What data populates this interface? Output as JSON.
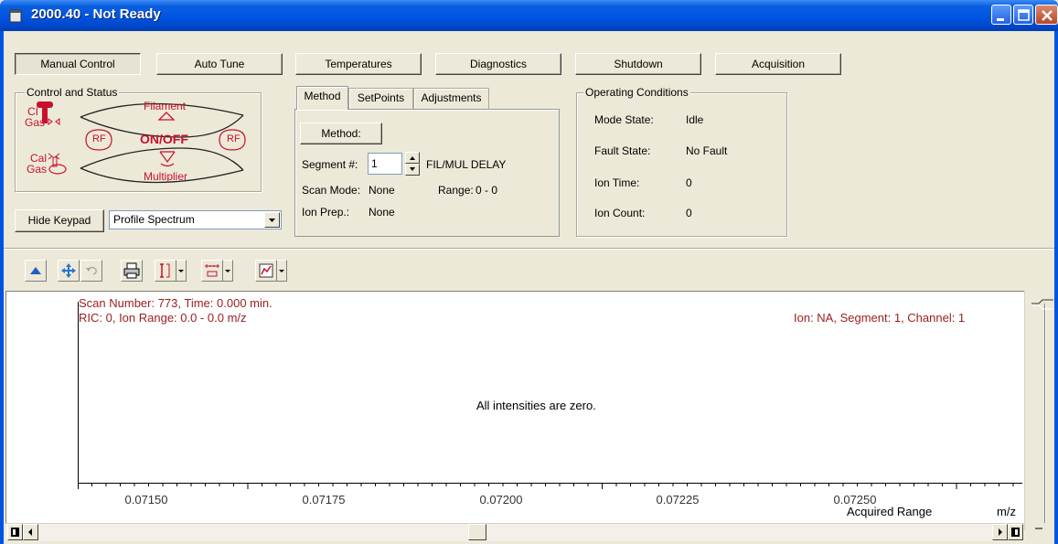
{
  "window": {
    "title": "2000.40 - Not Ready"
  },
  "top_buttons": [
    {
      "label": "Manual Control",
      "pressed": true
    },
    {
      "label": "Auto Tune",
      "pressed": false
    },
    {
      "label": "Temperatures",
      "pressed": false
    },
    {
      "label": "Diagnostics",
      "pressed": false
    },
    {
      "label": "Shutdown",
      "pressed": false
    },
    {
      "label": "Acquisition",
      "pressed": false
    }
  ],
  "control_status": {
    "title": "Control and Status",
    "ci_gas_top": "CI",
    "ci_gas_bottom": "Gas",
    "filament": "Filament",
    "rf_left": "RF",
    "onoff": "ON/OFF",
    "rf_right": "RF",
    "cal_gas_top": "Cal",
    "cal_gas_bottom": "Gas",
    "multiplier": "Multiplier",
    "accent_color": "#c8102e"
  },
  "keypad": {
    "hide_label": "Hide Keypad",
    "spectrum_mode": "Profile Spectrum"
  },
  "tabs": [
    {
      "label": "Method",
      "active": true
    },
    {
      "label": "SetPoints",
      "active": false
    },
    {
      "label": "Adjustments",
      "active": false
    }
  ],
  "method_panel": {
    "method_button": "Method:",
    "segment_label": "Segment #:",
    "segment_value": "1",
    "segment_info": "FIL/MUL DELAY",
    "scan_mode_label": "Scan Mode:",
    "scan_mode_value": "None",
    "range_label": "Range:",
    "range_value": "0 - 0",
    "ion_prep_label": "Ion Prep.:",
    "ion_prep_value": "None"
  },
  "operating_conditions": {
    "title": "Operating Conditions",
    "rows": [
      {
        "label": "Mode State:",
        "value": "Idle"
      },
      {
        "label": "Fault State:",
        "value": "No Fault"
      },
      {
        "label": "Ion Time:",
        "value": "0"
      },
      {
        "label": "Ion Count:",
        "value": "0"
      }
    ]
  },
  "toolbar": {
    "icons": [
      "up-arrow-icon",
      "move-icon",
      "undo-icon",
      "print-icon",
      "cursor-icon",
      "scale-icon",
      "chart-icon"
    ]
  },
  "spectrum": {
    "header_line1": "Scan Number: 773, Time: 0.000 min.",
    "header_line2": "RIC: 0,  Ion Range: 0.0 - 0.0 m/z",
    "header_right": "Ion: NA, Segment: 1,  Channel: 1",
    "message": "All intensities are zero.",
    "x_ticks": [
      "0.07150",
      "0.07175",
      "0.07200",
      "0.07225",
      "0.07250"
    ],
    "range_label": "Acquired Range",
    "unit_label": "m/z",
    "text_color": "#9b1c1c"
  }
}
